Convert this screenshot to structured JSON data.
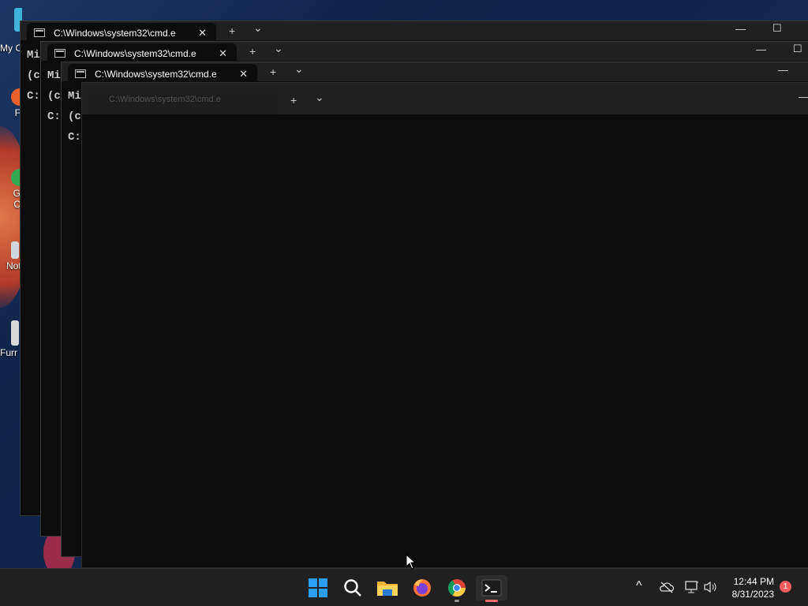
{
  "desktop": {
    "icons": [
      {
        "label": "My C"
      },
      {
        "label": "F"
      },
      {
        "label": "G\nC"
      },
      {
        "label": "Not"
      },
      {
        "label": "Furr"
      }
    ]
  },
  "windows": [
    {
      "title": "C:\\Windows\\system32\\cmd.e",
      "lines": [
        "Mi",
        "(c",
        "",
        "C:"
      ]
    },
    {
      "title": "C:\\Windows\\system32\\cmd.e",
      "lines": [
        "Mi",
        "(c",
        "",
        "C:"
      ]
    },
    {
      "title": "C:\\Windows\\system32\\cmd.e",
      "lines": [
        "Mi",
        "(c",
        "",
        "C:"
      ]
    },
    {
      "title": "C:\\Windows\\system32\\cmd.e",
      "lines": []
    }
  ],
  "tab_controls": {
    "new_tab": "+",
    "dropdown": "⌄",
    "close": "✕",
    "minimize": "—",
    "maximize": "☐"
  },
  "taskbar": {
    "icons": [
      "windows-start-icon",
      "search-icon",
      "file-explorer-icon",
      "firefox-icon",
      "chrome-icon",
      "terminal-icon"
    ],
    "tray": {
      "chevron": "^",
      "time": "12:44 PM",
      "date": "8/31/2023",
      "notifications": "1"
    }
  }
}
